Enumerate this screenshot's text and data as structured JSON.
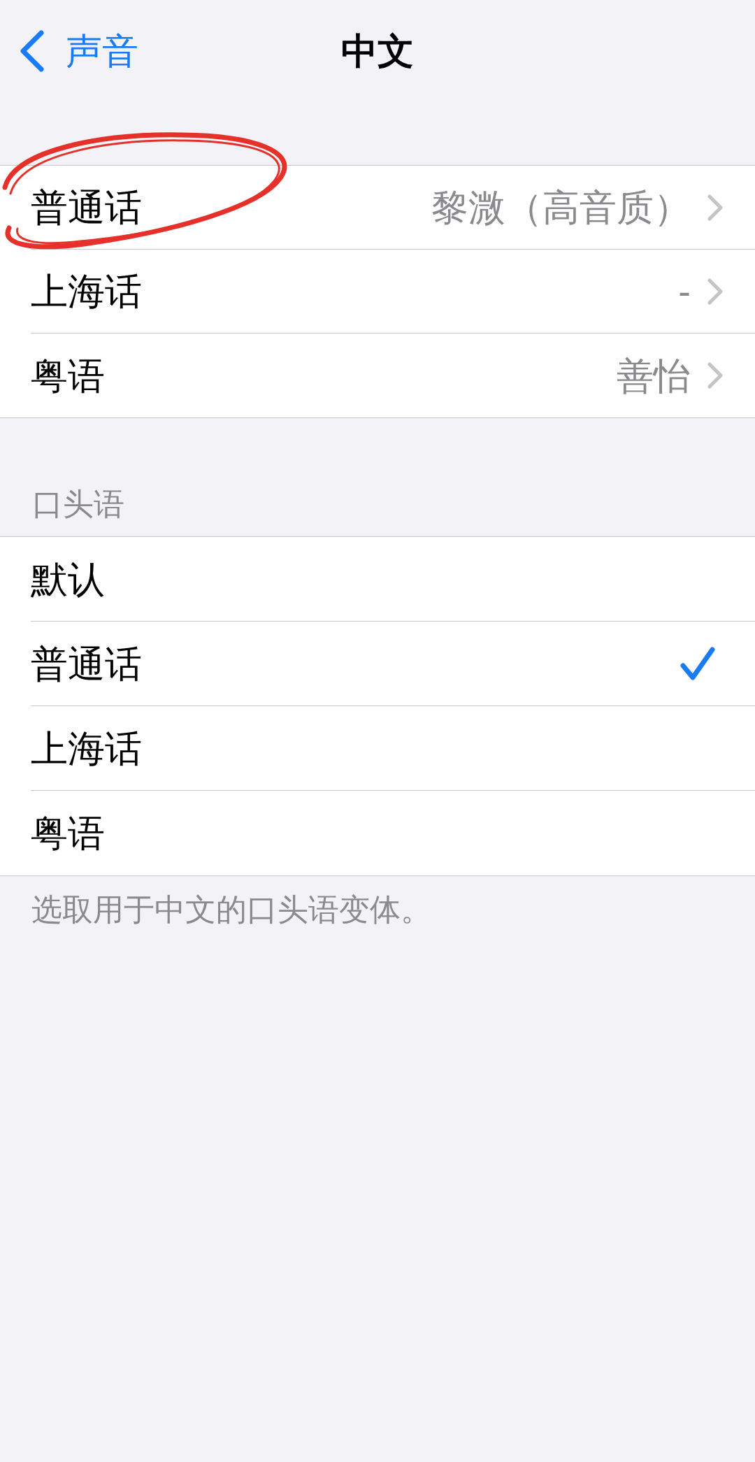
{
  "nav": {
    "back_label": "声音",
    "title": "中文"
  },
  "voices": {
    "rows": [
      {
        "label": "普通话",
        "value": "黎溦（高音质）",
        "circled": true
      },
      {
        "label": "上海话",
        "value": "-",
        "circled": false
      },
      {
        "label": "粤语",
        "value": "善怡",
        "circled": false
      }
    ]
  },
  "spoken": {
    "header": "口头语",
    "items": [
      {
        "label": "默认",
        "selected": false
      },
      {
        "label": "普通话",
        "selected": true
      },
      {
        "label": "上海话",
        "selected": false
      },
      {
        "label": "粤语",
        "selected": false
      }
    ],
    "footer": "选取用于中文的口头语变体。"
  }
}
